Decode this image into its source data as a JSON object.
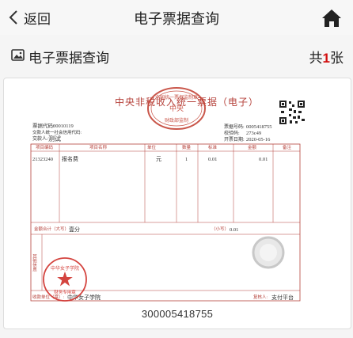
{
  "nav": {
    "back_label": "返回",
    "title": "电子票据查询",
    "home_icon": "home-icon"
  },
  "sub": {
    "title": "电子票据查询",
    "count_prefix": "共",
    "count": "1",
    "count_suffix": "张"
  },
  "invoice": {
    "title_left": "中央非税收入统一票据（电子）",
    "title_right": "（电子）",
    "code_label": "票据代码:",
    "code": "00010119",
    "payer_id_label": "交款人统一社会信用代码:",
    "payer_label": "交款人:",
    "payer": "测试",
    "number_label": "票据号码:",
    "number_small": "0005418755",
    "check_label": "校验码:",
    "check": "273c49",
    "date_label": "开票日期:",
    "date": "2020-05-16",
    "headers": [
      "项目编码",
      "项目名称",
      "单位",
      "数量",
      "标准",
      "金额",
      "备注"
    ],
    "row": {
      "code": "21323240",
      "name": "报名费",
      "unit": "元",
      "qty": "1",
      "std": "0.01",
      "amount": "0.01"
    },
    "total_label": "金额合计（大写）",
    "total_upper": "壹分",
    "total_small_label": "（小写）",
    "total_small": "0.01",
    "other_label": "其他信息",
    "payee_label": "收款单位（章）:",
    "payee": "中华女子学院",
    "reviewer_label": "复核人:",
    "reviewer": "支付平台",
    "seal_top_text": "全国统一票据监制章",
    "seal_mid_text": "财政部监制",
    "seal_center": "中央",
    "stamp_text": "中华女子学院",
    "stamp_bottom": "财务专用章",
    "bottom_number": "300005418755"
  }
}
